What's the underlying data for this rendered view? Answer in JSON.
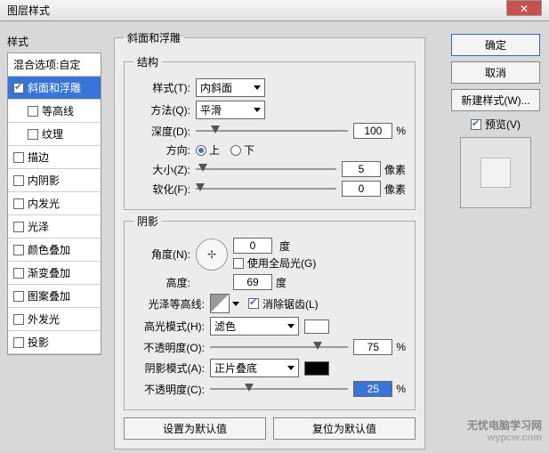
{
  "window": {
    "title": "图层样式"
  },
  "left": {
    "heading": "样式",
    "blend": "混合选项:自定",
    "items": [
      {
        "label": "斜面和浮雕",
        "checked": true,
        "selected": true
      },
      {
        "label": "等高线",
        "checked": false,
        "indent": true
      },
      {
        "label": "纹理",
        "checked": false,
        "indent": true
      },
      {
        "label": "描边",
        "checked": false
      },
      {
        "label": "内阴影",
        "checked": false
      },
      {
        "label": "内发光",
        "checked": false
      },
      {
        "label": "光泽",
        "checked": false
      },
      {
        "label": "颜色叠加",
        "checked": false
      },
      {
        "label": "渐变叠加",
        "checked": false
      },
      {
        "label": "图案叠加",
        "checked": false
      },
      {
        "label": "外发光",
        "checked": false
      },
      {
        "label": "投影",
        "checked": false
      }
    ]
  },
  "right": {
    "ok": "确定",
    "cancel": "取消",
    "newstyle": "新建样式(W)...",
    "preview": "预览(V)"
  },
  "bevel": {
    "legend": "斜面和浮雕",
    "structure": {
      "legend": "结构",
      "style_l": "样式(T):",
      "style_v": "内斜面",
      "tech_l": "方法(Q):",
      "tech_v": "平滑",
      "depth_l": "深度(D):",
      "depth_v": "100",
      "depth_u": "%",
      "dir_l": "方向:",
      "dir_up": "上",
      "dir_down": "下",
      "size_l": "大小(Z):",
      "size_v": "5",
      "size_u": "像素",
      "soft_l": "软化(F):",
      "soft_v": "0",
      "soft_u": "像素"
    },
    "shading": {
      "legend": "阴影",
      "angle_l": "角度(N):",
      "angle_v": "0",
      "angle_u": "度",
      "global": "使用全局光(G)",
      "alt_l": "高度:",
      "alt_v": "69",
      "alt_u": "度",
      "gloss_l": "光泽等高线:",
      "aa": "消除锯齿(L)",
      "hi_mode_l": "高光模式(H):",
      "hi_mode_v": "滤色",
      "op1_l": "不透明度(O):",
      "op1_v": "75",
      "op1_u": "%",
      "sh_mode_l": "阴影模式(A):",
      "sh_mode_v": "正片叠底",
      "op2_l": "不透明度(C):",
      "op2_v": "25",
      "op2_u": "%"
    },
    "defaults": {
      "make": "设置为默认值",
      "reset": "复位为默认值"
    }
  },
  "watermark": {
    "l1": "无忧电脑学习网",
    "l2": "wypcw.com"
  }
}
